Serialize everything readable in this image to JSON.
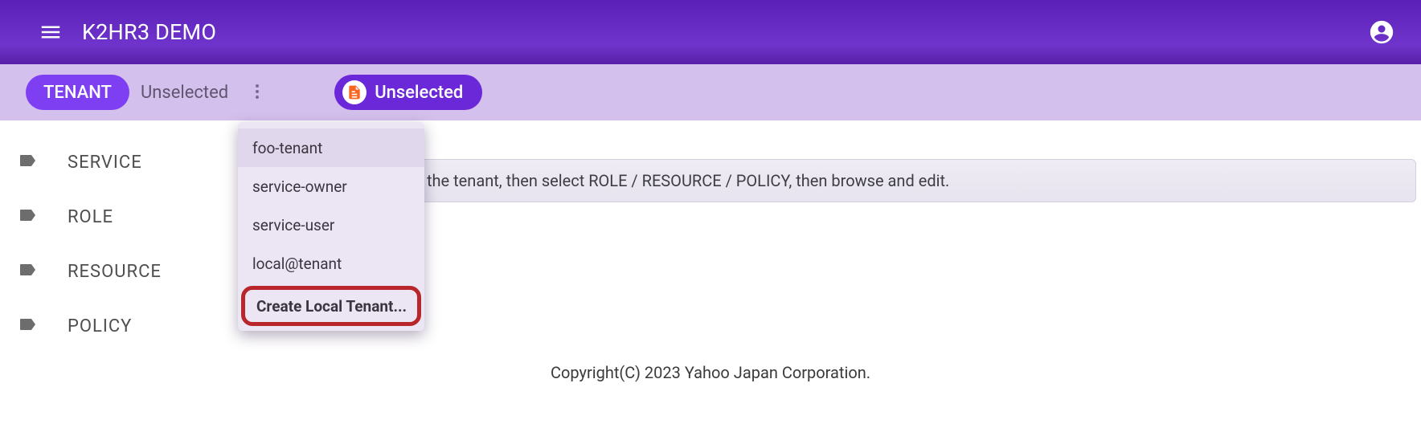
{
  "appbar": {
    "title": "K2HR3 DEMO"
  },
  "subbar": {
    "tenant_chip": "TENANT",
    "tenant_value": "Unselected",
    "status_value": "Unselected"
  },
  "sidebar": {
    "items": [
      {
        "label": "SERVICE"
      },
      {
        "label": "ROLE"
      },
      {
        "label": "RESOURCE"
      },
      {
        "label": "POLICY"
      }
    ]
  },
  "main": {
    "banner_visible": "the tenant, then select ROLE / RESOURCE / POLICY, then browse and edit."
  },
  "dropdown": {
    "options": [
      {
        "label": "foo-tenant"
      },
      {
        "label": "service-owner"
      },
      {
        "label": "service-user"
      },
      {
        "label": "local@tenant"
      }
    ],
    "create_label": "Create Local Tenant..."
  },
  "footer": {
    "copyright": "Copyright(C) 2023 Yahoo Japan Corporation."
  },
  "colors": {
    "appbar_gradient_top": "#5a1fb7",
    "appbar_gradient_bottom": "#5820a7",
    "subbar_bg": "#d4c0ec",
    "primary_purple": "#7e3ff2",
    "chip_status_bg": "#6b28d9",
    "status_icon_orange": "#f9651f",
    "highlight_red": "#b8252a"
  },
  "icons": {
    "menu": "menu-icon",
    "account": "account-circle-icon",
    "kebab": "more-vert-icon",
    "status": "description-icon",
    "tag": "label-icon"
  }
}
